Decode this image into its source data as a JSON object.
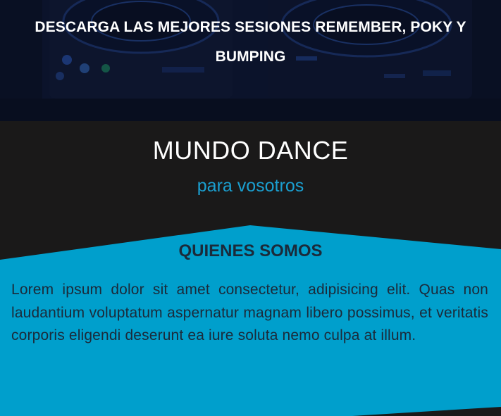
{
  "hero": {
    "title": "DESCARGA LAS MEJORES SESIONES REMEMBER, POKY Y BUMPING"
  },
  "brand": {
    "title": "MUNDO DANCE",
    "subtitle": "para vosotros"
  },
  "about": {
    "heading": "QUIENES SOMOS",
    "text": "Lorem ipsum dolor sit amet consectetur, adipisicing elit. Quas non laudantium voluptatum aspernatur magnam libero possimus, et veritatis corporis eligendi deserunt ea iure soluta nemo culpa at illum."
  },
  "colors": {
    "page_background": "#1a1919",
    "accent": "#009fcc",
    "subtitle": "#1a9fd0",
    "dark_text": "#1b2a3a",
    "hero_text": "#ffffff"
  }
}
